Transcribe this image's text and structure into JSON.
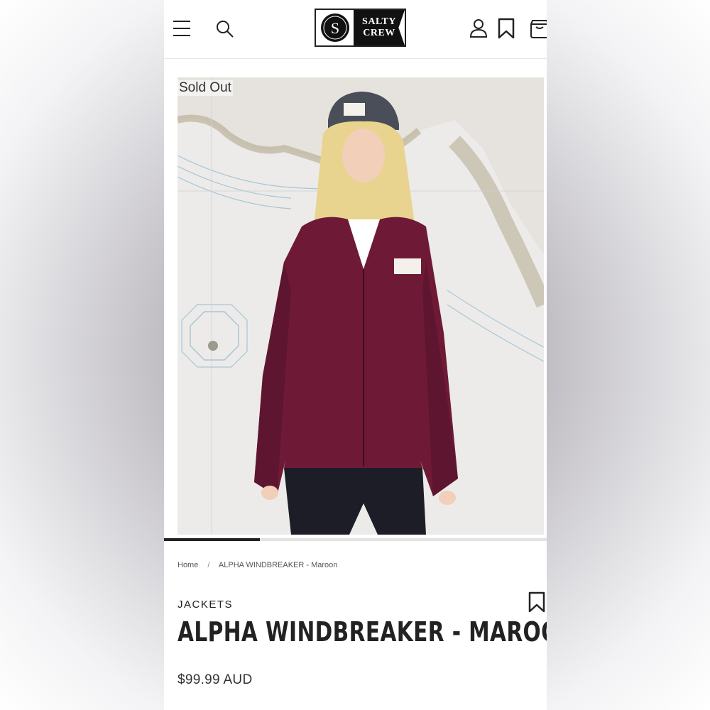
{
  "brand": {
    "logo_text_line1": "SALTY",
    "logo_text_line2": "CREW",
    "logo_mark": "S"
  },
  "header": {
    "icons": [
      "menu-icon",
      "search-icon",
      "account-icon",
      "bookmark-icon",
      "cart-icon"
    ]
  },
  "gallery": {
    "badge": "Sold Out",
    "progress_fraction": 0.25,
    "image_alt": "Model wearing maroon windbreaker jacket and grey cap in front of nautical map"
  },
  "breadcrumb": {
    "home": "Home",
    "separator": "/",
    "current": "ALPHA WINDBREAKER - Maroon"
  },
  "product": {
    "category": "JACKETS",
    "title": "ALPHA WINDBREAKER - MAROON",
    "price": "$99.99 AUD"
  },
  "colors": {
    "jacket": "#6e1a36",
    "text": "#222222",
    "progress": "#222222"
  }
}
